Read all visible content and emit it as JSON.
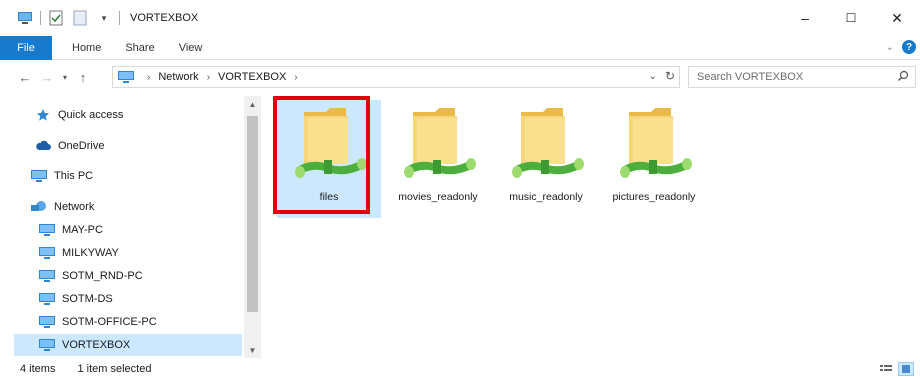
{
  "window": {
    "title": "VORTEXBOX",
    "controls": {
      "minimize": "–",
      "maximize": "☐",
      "close": "✕"
    }
  },
  "ribbon": {
    "tabs": [
      "File",
      "Home",
      "Share",
      "View"
    ],
    "help": "?"
  },
  "address": {
    "crumbs": [
      "Network",
      "VORTEXBOX"
    ],
    "search_placeholder": "Search VORTEXBOX"
  },
  "nav": {
    "quick_access": "Quick access",
    "onedrive": "OneDrive",
    "this_pc": "This PC",
    "network": "Network",
    "computers": [
      "MAY-PC",
      "MILKYWAY",
      "SOTM_RND-PC",
      "SOTM-DS",
      "SOTM-OFFICE-PC",
      "VORTEXBOX"
    ]
  },
  "folders": [
    {
      "name": "files",
      "selected": true
    },
    {
      "name": "movies_readonly",
      "selected": false
    },
    {
      "name": "music_readonly",
      "selected": false
    },
    {
      "name": "pictures_readonly",
      "selected": false
    }
  ],
  "status": {
    "items": "4 items",
    "selected": "1 item selected"
  },
  "colors": {
    "accent": "#1979ca",
    "selection": "#cce8ff",
    "highlight": "#e2000f",
    "folder": "#f4cf6a",
    "network_pipe": "#4caf3d"
  }
}
